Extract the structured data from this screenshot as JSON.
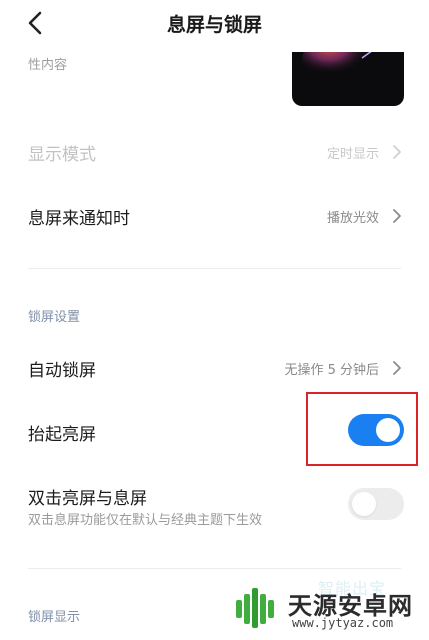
{
  "header": {
    "title": "息屏与锁屏"
  },
  "top_hint": "性内容",
  "display_mode": {
    "label": "显示模式",
    "value": "定时显示"
  },
  "notify": {
    "label": "息屏来通知时",
    "value": "播放光效"
  },
  "lock_section": {
    "title": "锁屏设置",
    "auto_lock": {
      "label": "自动锁屏",
      "value": "无操作 5 分钟后"
    },
    "raise_wake": {
      "label": "抬起亮屏",
      "enabled": true
    },
    "double_tap": {
      "label": "双击亮屏与息屏",
      "desc": "双击息屏功能仅在默认与经典主题下生效",
      "enabled": false
    }
  },
  "faded_text": "智能出宝",
  "lock_display_section": {
    "title": "锁屏显示"
  },
  "watermark": {
    "name": "天源安卓网",
    "url": "www.jytyaz.com"
  },
  "colors": {
    "accent": "#1a7ff0",
    "highlight": "#d9252a",
    "section": "#7f8fa8"
  }
}
